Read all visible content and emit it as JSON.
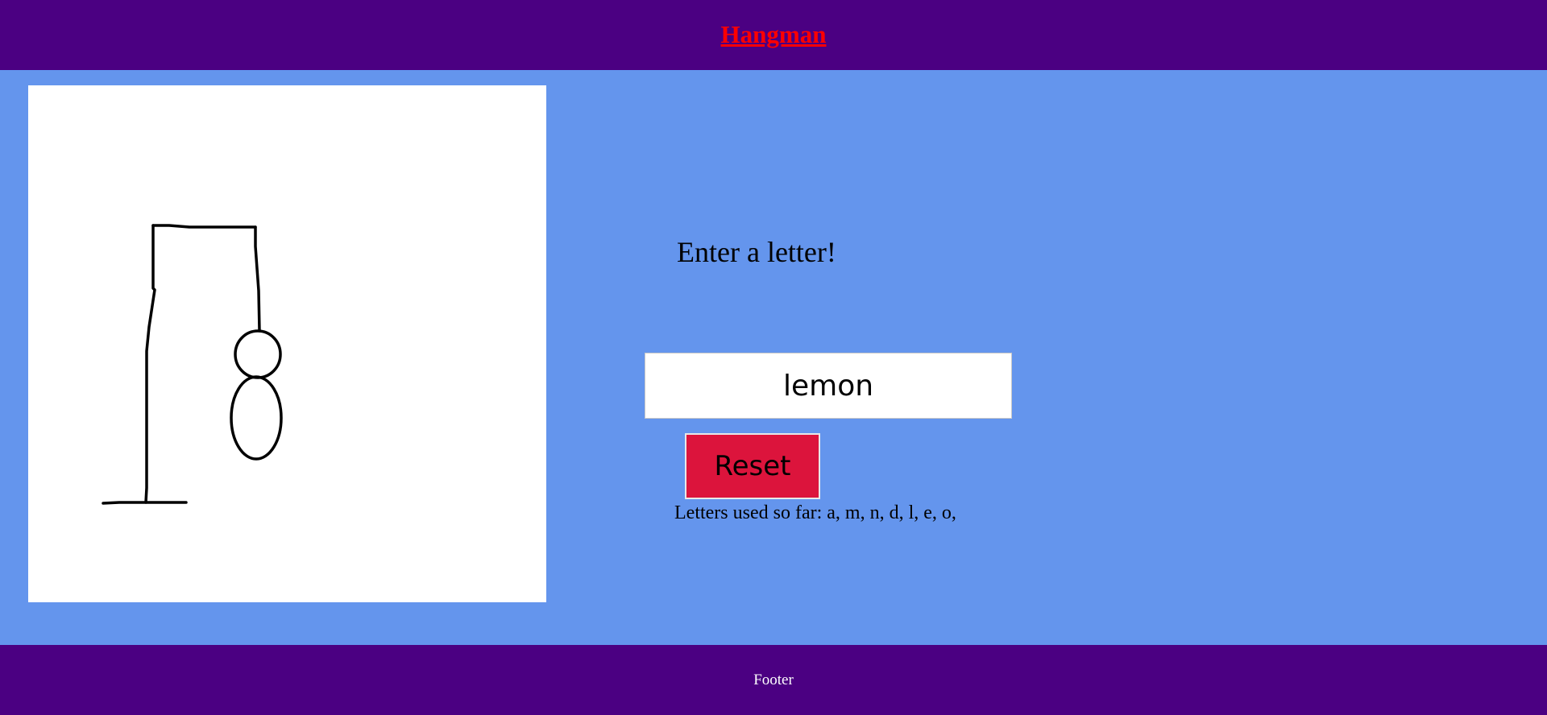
{
  "header": {
    "title": "Hangman"
  },
  "game": {
    "prompt": "Enter a letter!",
    "input_value": "lemon",
    "reset_label": "Reset",
    "letters_used_text": "Letters used so far: a, m, n, d, l, e, o,"
  },
  "footer": {
    "text": "Footer"
  },
  "colors": {
    "header_bg": "#4B0082",
    "page_bg": "#6495ED",
    "title": "#FF0000",
    "reset_button": "#DC143C",
    "canvas_bg": "#FFFFFF"
  },
  "icons": {
    "drawing": "hangman-drawing"
  }
}
